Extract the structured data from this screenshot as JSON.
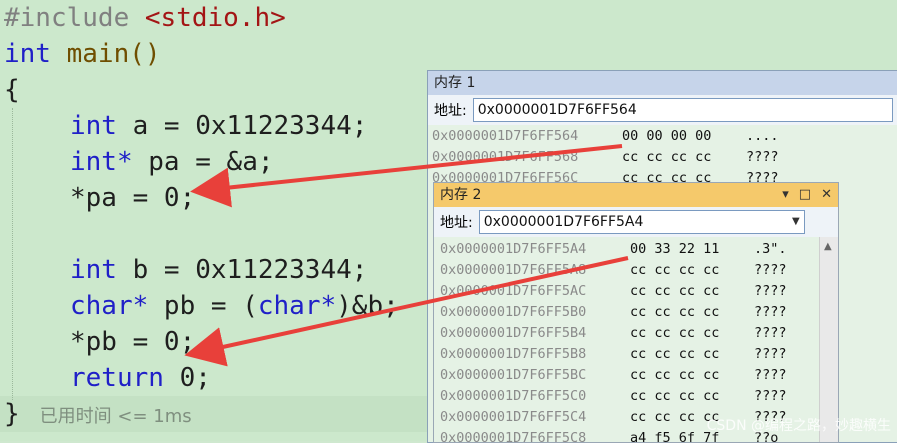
{
  "editor": {
    "lines": {
      "l1_pp": "#include",
      "l1_str": "<stdio.h>",
      "l2_kw": "int",
      "l2_fn": " main()",
      "l3": "{",
      "l4_kw": "int",
      "l4_rest": " a = 0x11223344;",
      "l5_kw": "int*",
      "l5_rest": " pa = &a;",
      "l6": "*pa = 0;",
      "l8_kw": "int",
      "l8_rest": " b = 0x11223344;",
      "l9_kw": "char*",
      "l9_rest1": " pb = (",
      "l9_kw2": "char*",
      "l9_rest2": ")&b;",
      "l10": "*pb = 0;",
      "l11_kw": "return",
      "l11_rest": " 0;",
      "l12": "}",
      "elapsed_hint": "已用时间 <= 1ms"
    }
  },
  "mem1": {
    "title": "内存 1",
    "addr_label": "地址:",
    "addr_value": "0x0000001D7F6FF564",
    "rows": [
      {
        "addr": "0x0000001D7F6FF564",
        "bytes": "00 00 00 00",
        "ascii": "...."
      },
      {
        "addr": "0x0000001D7F6FF568",
        "bytes": "cc cc cc cc",
        "ascii": "????"
      },
      {
        "addr": "0x0000001D7F6FF56C",
        "bytes": "cc cc cc cc",
        "ascii": "????"
      }
    ]
  },
  "mem2": {
    "title": "内存 2",
    "addr_label": "地址:",
    "addr_value": "0x0000001D7F6FF5A4",
    "rows": [
      {
        "addr": "0x0000001D7F6FF5A4",
        "bytes": "00 33 22 11",
        "ascii": ".3\"."
      },
      {
        "addr": "0x0000001D7F6FF5A8",
        "bytes": "cc cc cc cc",
        "ascii": "????"
      },
      {
        "addr": "0x0000001D7F6FF5AC",
        "bytes": "cc cc cc cc",
        "ascii": "????"
      },
      {
        "addr": "0x0000001D7F6FF5B0",
        "bytes": "cc cc cc cc",
        "ascii": "????"
      },
      {
        "addr": "0x0000001D7F6FF5B4",
        "bytes": "cc cc cc cc",
        "ascii": "????"
      },
      {
        "addr": "0x0000001D7F6FF5B8",
        "bytes": "cc cc cc cc",
        "ascii": "????"
      },
      {
        "addr": "0x0000001D7F6FF5BC",
        "bytes": "cc cc cc cc",
        "ascii": "????"
      },
      {
        "addr": "0x0000001D7F6FF5C0",
        "bytes": "cc cc cc cc",
        "ascii": "????"
      },
      {
        "addr": "0x0000001D7F6FF5C4",
        "bytes": "cc cc cc cc",
        "ascii": "????"
      },
      {
        "addr": "0x0000001D7F6FF5C8",
        "bytes": "a4 f5 6f 7f",
        "ascii": "??o"
      }
    ]
  },
  "watermark": "CSDN @编程之路，妙趣横生",
  "colors": {
    "editor_bg": "#cce8cc",
    "keyword": "#2020c8",
    "arrow": "#e8403a",
    "mem2_title": "#f5c96b"
  }
}
